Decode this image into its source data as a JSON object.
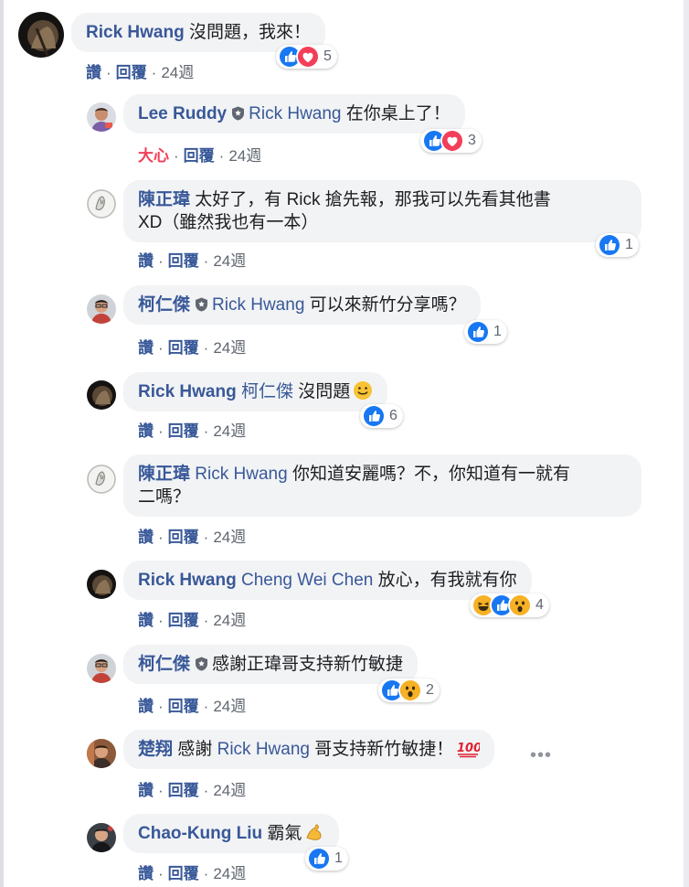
{
  "comments": [
    {
      "name": "Rick Hwang",
      "text": "沒問題，我來！",
      "meta": {
        "action": "讚",
        "reply": "回覆",
        "time": "24週"
      },
      "reactions": {
        "count": "5"
      }
    },
    {
      "name": "Lee Ruddy",
      "mention": "Rick Hwang",
      "text": "在你桌上了！",
      "meta": {
        "action": "大心",
        "reply": "回覆",
        "time": "24週"
      },
      "reactions": {
        "count": "3"
      }
    },
    {
      "name": "陳正瑋",
      "text_line1": "太好了，有 Rick 搶先報，那我可以先看其他書",
      "text_line2": "XD（雖然我也有一本）",
      "meta": {
        "action": "讚",
        "reply": "回覆",
        "time": "24週"
      },
      "reactions": {
        "count": "1"
      }
    },
    {
      "name": "柯仁傑",
      "mention": "Rick Hwang",
      "text": "可以來新竹分享嗎？",
      "meta": {
        "action": "讚",
        "reply": "回覆",
        "time": "24週"
      },
      "reactions": {
        "count": "1"
      }
    },
    {
      "name": "Rick Hwang",
      "mention": "柯仁傑",
      "text": "沒問題",
      "meta": {
        "action": "讚",
        "reply": "回覆",
        "time": "24週"
      },
      "reactions": {
        "count": "6"
      }
    },
    {
      "name": "陳正瑋",
      "mention": "Rick Hwang",
      "text_line1": "你知道安麗嗎？不，你知道有一就有",
      "text_line2": "二嗎？",
      "meta": {
        "action": "讚",
        "reply": "回覆",
        "time": "24週"
      }
    },
    {
      "name": "Rick Hwang",
      "mention": "Cheng Wei Chen",
      "text": "放心，有我就有你",
      "meta": {
        "action": "讚",
        "reply": "回覆",
        "time": "24週"
      },
      "reactions": {
        "count": "4"
      }
    },
    {
      "name": "柯仁傑",
      "text": "感謝正瑋哥支持新竹敏捷",
      "meta": {
        "action": "讚",
        "reply": "回覆",
        "time": "24週"
      },
      "reactions": {
        "count": "2"
      }
    },
    {
      "name": "楚翔",
      "text_pre": "感謝",
      "mention": "Rick Hwang",
      "text": "哥支持新竹敏捷！",
      "meta": {
        "action": "讚",
        "reply": "回覆",
        "time": "24週"
      },
      "more": "•••"
    },
    {
      "name": "Chao-Kung Liu",
      "text": "霸氣",
      "meta": {
        "action": "讚",
        "reply": "回覆",
        "time": "24週"
      },
      "reactions": {
        "count": "1"
      }
    }
  ],
  "colors": {
    "link": "#385898",
    "love": "#f33e58",
    "like": "#1877f2",
    "bubble": "#f2f3f5",
    "meta": "#606770"
  },
  "icons": {
    "like": "like-icon",
    "love": "love-icon",
    "haha": "haha-icon",
    "wow": "wow-icon",
    "verified": "shield-icon",
    "smile": "smile-emoji",
    "hundred": "hundred-emoji",
    "muscle": "muscle-emoji"
  }
}
